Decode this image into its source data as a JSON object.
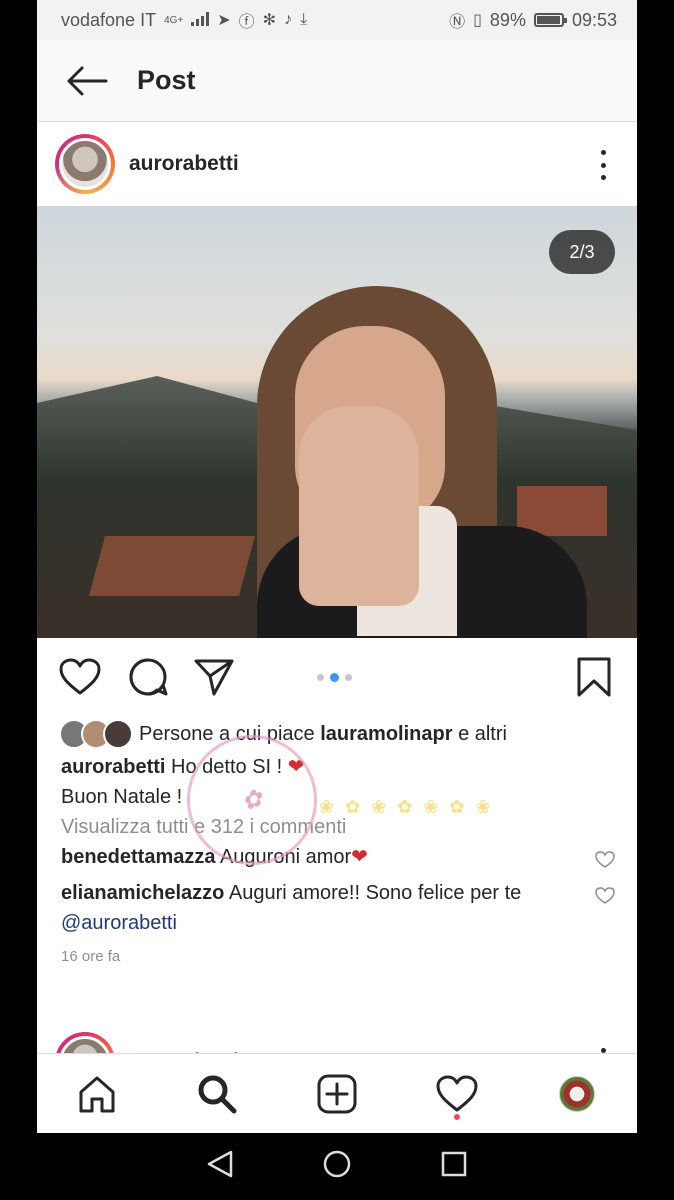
{
  "status_bar": {
    "carrier": "vodafone IT",
    "network": "4G+",
    "icons": [
      "signal-icon",
      "telegram-icon",
      "facebook-icon",
      "flower-icon",
      "tiktok-icon",
      "download-icon",
      "nfc-icon",
      "vibrate-icon"
    ],
    "battery": "89%",
    "battery_level": 0.89,
    "time": "09:53"
  },
  "header": {
    "title": "Post"
  },
  "post": {
    "username": "aurorabetti",
    "carousel_counter": "2/3",
    "carousel_total": 3,
    "carousel_index": 2,
    "likes_prefix": "Persone a cui piace",
    "likes_user": "lauramolinapr",
    "likes_suffix": "e altri",
    "caption_line1": "Ho detto SI !",
    "caption_emoji": "❤",
    "caption_line2": "Buon Natale !",
    "view_comments": "Visualizza tutti e 312 i commenti",
    "comments": [
      {
        "user": "benedettamazza",
        "text": "Auguroni amor",
        "emoji": "❤"
      },
      {
        "user": "elianamichelazzo",
        "text": "Auguri amore!! Sono felice per te",
        "mention": "@aurorabetti"
      }
    ],
    "time_ago": "16 ore fa"
  },
  "next_post": {
    "username": "aurorabetti"
  },
  "bottom_nav": [
    "home-icon",
    "search-icon",
    "add-icon",
    "activity-icon",
    "profile-icon"
  ],
  "colors": {
    "accent_blue": "#3897f0",
    "like_red": "#d22c2c",
    "notif_red": "#ed4956",
    "text": "#262626",
    "secondary": "#8e8e8e"
  }
}
